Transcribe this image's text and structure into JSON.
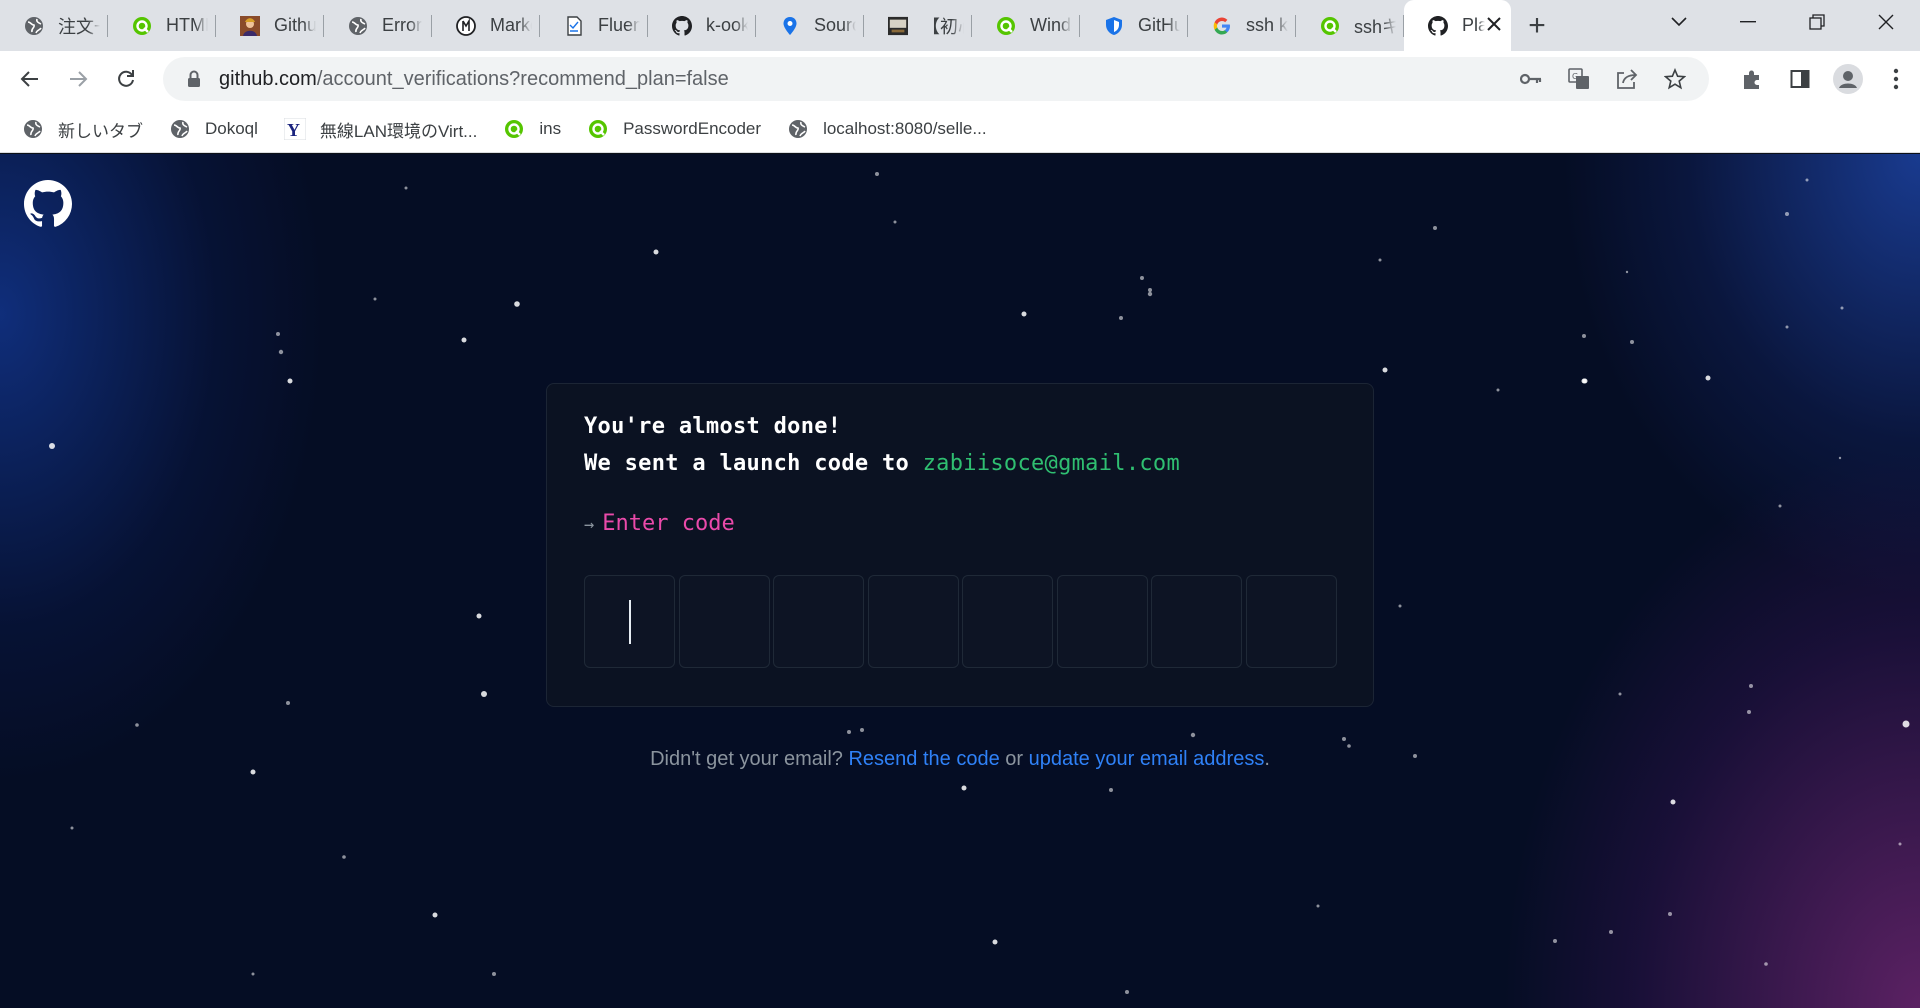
{
  "browser": {
    "tabs": [
      {
        "title": "注文一",
        "icon": "globe-icon"
      },
      {
        "title": "HTML",
        "icon": "green-q-icon"
      },
      {
        "title": "Github",
        "icon": "avatar-icon"
      },
      {
        "title": "Error",
        "icon": "globe-icon"
      },
      {
        "title": "Markd",
        "icon": "markdown-icon"
      },
      {
        "title": "Fluent",
        "icon": "document-icon"
      },
      {
        "title": "k-ook",
        "icon": "github-icon"
      },
      {
        "title": "Source",
        "icon": "map-pin-icon"
      },
      {
        "title": "【初心",
        "icon": "thumbnail-icon"
      },
      {
        "title": "Windo",
        "icon": "green-q-icon"
      },
      {
        "title": "GitHu",
        "icon": "shield-icon"
      },
      {
        "title": "ssh ke",
        "icon": "google-icon"
      },
      {
        "title": "sshキー",
        "icon": "green-q-icon"
      },
      {
        "title": "Pla",
        "icon": "github-icon",
        "active": true
      }
    ],
    "address": {
      "domain": "github.com",
      "path": "/account_verifications?recommend_plan=false"
    },
    "bookmarks": [
      {
        "label": "新しいタブ",
        "icon": "globe-icon"
      },
      {
        "label": "Dokoql",
        "icon": "globe-icon"
      },
      {
        "label": "無線LAN環境のVirt...",
        "icon": "yahoo-icon"
      },
      {
        "label": "ins",
        "icon": "green-q-icon"
      },
      {
        "label": "PasswordEncoder",
        "icon": "green-q-icon"
      },
      {
        "label": "localhost:8080/selle...",
        "icon": "globe-icon"
      }
    ]
  },
  "page": {
    "heading": "You're almost done!",
    "sent_prefix": "We sent a launch code to",
    "email": "zabiisoce@gmail.com",
    "prompt_arrow": "→",
    "prompt_label": "Enter code",
    "code_length": 8,
    "footer": {
      "prefix": "Didn't get your email?",
      "resend_link": "Resend the code",
      "or": "or",
      "update_link": "update your email address",
      "suffix": "."
    }
  },
  "colors": {
    "background": "#050d24",
    "card": "#0b1222",
    "email": "#2fbf71",
    "prompt": "#ea4aaa",
    "link": "#2f81f7"
  }
}
